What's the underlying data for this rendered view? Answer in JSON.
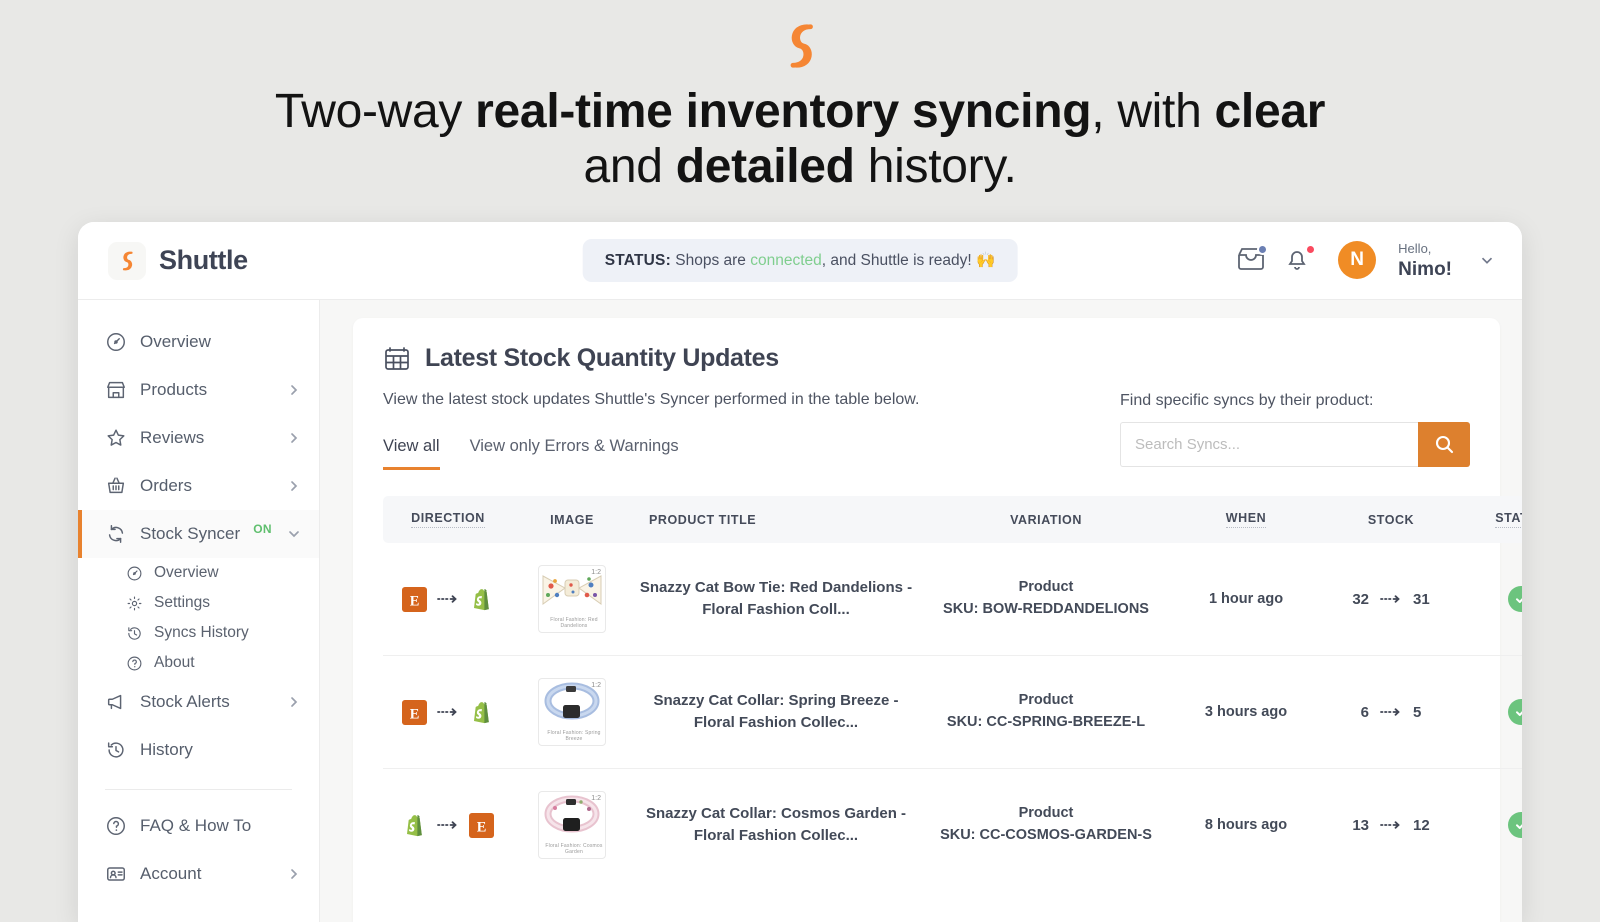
{
  "promo": {
    "logo_icon": "shuttle-logo",
    "headline_parts": [
      {
        "text": "Two-way ",
        "bold": false
      },
      {
        "text": "real-time inventory syncing",
        "bold": true
      },
      {
        "text": ", with ",
        "bold": false
      },
      {
        "text": "clear",
        "bold": true
      },
      {
        "text": " and ",
        "bold": false
      },
      {
        "text": "detailed",
        "bold": true
      },
      {
        "text": " history.",
        "bold": false
      }
    ],
    "headline_plain": "Two-way real-time inventory syncing, with clear and detailed history."
  },
  "colors": {
    "brand_orange": "#e8822e",
    "search_button": "#dd802e",
    "status_green": "#7fce8e",
    "success_green": "#6cc47e",
    "page_background": "#e8e8e6",
    "text_dark": "#3f4453",
    "notification_blue": "#6b7fb3",
    "notification_red": "#fa4a5f"
  },
  "topbar": {
    "brand_name": "Shuttle",
    "brand_logo_icon": "shuttle-logo",
    "status": {
      "label": "STATUS:",
      "text_before": "Shops are ",
      "highlight": "connected",
      "text_after": ", and Shuttle is ready! ",
      "emoji": "🙌"
    },
    "inbox_icon": "inbox-icon",
    "bell_icon": "bell-icon",
    "avatar_initial": "N",
    "greeting_line1": "Hello,",
    "greeting_line2": "Nimo!",
    "caret_icon": "chevron-down-icon"
  },
  "sidebar": {
    "items": [
      {
        "label": "Overview",
        "icon": "gauge-icon",
        "chevron": false,
        "active": false
      },
      {
        "label": "Products",
        "icon": "shop-icon",
        "chevron": true,
        "active": false
      },
      {
        "label": "Reviews",
        "icon": "star-icon",
        "chevron": true,
        "active": false
      },
      {
        "label": "Orders",
        "icon": "basket-icon",
        "chevron": true,
        "active": false
      },
      {
        "label": "Stock Syncer",
        "icon": "sync-icon",
        "chevron": true,
        "active": true,
        "badge": "ON",
        "expanded": true
      }
    ],
    "sub_items": [
      {
        "label": "Overview",
        "icon": "gauge-icon"
      },
      {
        "label": "Settings",
        "icon": "gear-icon"
      },
      {
        "label": "Syncs History",
        "icon": "clock-back-icon"
      },
      {
        "label": "About",
        "icon": "question-circle-icon"
      }
    ],
    "items_after": [
      {
        "label": "Stock Alerts",
        "icon": "megaphone-icon",
        "chevron": true
      },
      {
        "label": "History",
        "icon": "history-icon",
        "chevron": false
      }
    ],
    "footer_items": [
      {
        "label": "FAQ & How To",
        "icon": "question-circle-icon",
        "chevron": false
      },
      {
        "label": "Account",
        "icon": "id-card-icon",
        "chevron": true
      }
    ]
  },
  "main": {
    "title": "Latest Stock Quantity Updates",
    "title_icon": "table-icon",
    "subtitle": "View the latest stock updates Shuttle's Syncer performed in the table below.",
    "tabs": [
      {
        "label": "View all",
        "active": true
      },
      {
        "label": "View only Errors & Warnings",
        "active": false
      }
    ],
    "search": {
      "label": "Find specific syncs by their product:",
      "placeholder": "Search Syncs...",
      "value": "",
      "button_icon": "search-icon"
    },
    "table": {
      "columns": [
        {
          "label": "DIRECTION",
          "dotted": true
        },
        {
          "label": "IMAGE",
          "dotted": false
        },
        {
          "label": "PRODUCT TITLE",
          "dotted": false
        },
        {
          "label": "VARIATION",
          "dotted": false
        },
        {
          "label": "WHEN",
          "dotted": true
        },
        {
          "label": "STOCK",
          "dotted": false
        },
        {
          "label": "STATUS",
          "dotted": true
        }
      ],
      "rows": [
        {
          "from": "etsy",
          "to": "shopify",
          "thumb_badge": "1:2",
          "thumb_caption": "Floral Fashion: Red Dandelions",
          "thumb_kind": "bowtie-red-dandelions",
          "product_title": "Snazzy Cat Bow Tie: Red Dandelions - Floral Fashion Coll...",
          "variation_line1": "Product",
          "variation_line2": "SKU: BOW-REDDANDELIONS",
          "when": "1 hour ago",
          "stock_from": "32",
          "stock_to": "31",
          "status": "success"
        },
        {
          "from": "etsy",
          "to": "shopify",
          "thumb_badge": "1:2",
          "thumb_caption": "Floral Fashion: Spring Breeze",
          "thumb_kind": "collar-spring-breeze",
          "product_title": "Snazzy Cat Collar: Spring Breeze - Floral Fashion Collec...",
          "variation_line1": "Product",
          "variation_line2": "SKU: CC-SPRING-BREEZE-L",
          "when": "3 hours ago",
          "stock_from": "6",
          "stock_to": "5",
          "status": "success"
        },
        {
          "from": "shopify",
          "to": "etsy",
          "thumb_badge": "1:2",
          "thumb_caption": "Floral Fashion: Cosmos Garden",
          "thumb_kind": "collar-cosmos-garden",
          "product_title": "Snazzy Cat Collar: Cosmos Garden - Floral Fashion Collec...",
          "variation_line1": "Product",
          "variation_line2": "SKU: CC-COSMOS-GARDEN-S",
          "when": "8 hours ago",
          "stock_from": "13",
          "stock_to": "12",
          "status": "success"
        }
      ]
    }
  }
}
